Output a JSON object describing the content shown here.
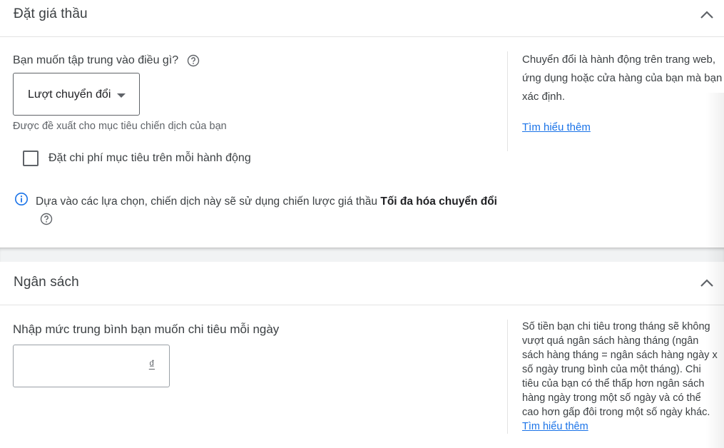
{
  "bidding": {
    "title": "Đặt giá thầu",
    "question": "Bạn muốn tập trung vào điều gì?",
    "dropdown_value": "Lượt chuyển đổi",
    "recommended_hint": "Được đề xuất cho mục tiêu chiến dịch của bạn",
    "checkbox_label": "Đặt chi phí mục tiêu trên mỗi hành động",
    "checkbox_checked": false,
    "info_text": "Dựa vào các lựa chọn, chiến dịch này sẽ sử dụng chiến lược giá thầu ",
    "info_strategy": "Tối đa hóa chuyển đổi",
    "side_lines": [
      "Chuyển đổi là hành động trên trang web,",
      "ứng dụng hoặc cửa hàng của bạn mà bạn",
      "xác định."
    ],
    "learn_more": "Tìm hiểu thêm"
  },
  "budget": {
    "title": "Ngân sách",
    "prompt": "Nhập mức trung bình bạn muốn chi tiêu mỗi ngày",
    "input_value": "",
    "currency_symbol": "₫",
    "side_text": "Số tiền bạn chi tiêu trong tháng sẽ không vượt quá ngân sách hàng tháng (ngân sách hàng tháng = ngân sách hàng ngày x số ngày trung bình của một tháng). Chi tiêu của bạn có thể thấp hơn ngân sách hàng ngày trong một số ngày và có thể cao hơn gấp đôi trong một số ngày khác.",
    "learn_more": "Tìm hiểu thêm"
  },
  "colors": {
    "link": "#1a73e8",
    "text": "#3c4043",
    "muted": "#5f6368",
    "divider": "#e3e3e3"
  },
  "icons": {
    "collapse": "chevron-up-icon",
    "help": "help-circle-icon",
    "info": "info-icon",
    "dropdown": "caret-down-icon"
  }
}
